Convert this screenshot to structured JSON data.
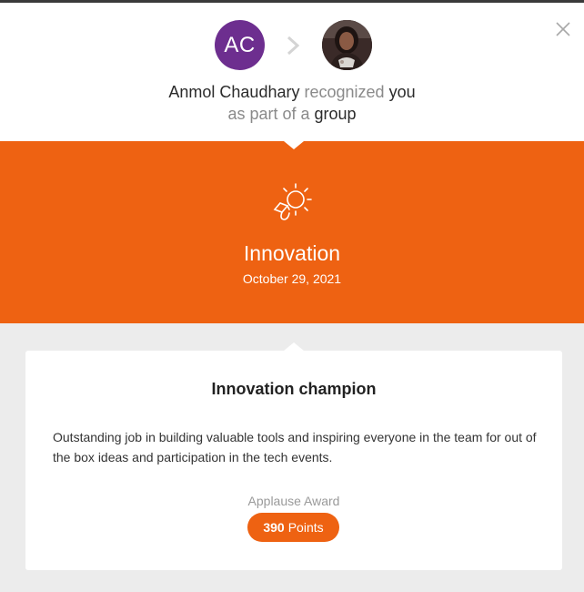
{
  "header": {
    "sender_initials": "AC",
    "sender_name": "Anmol Chaudhary",
    "verb": "recognized",
    "recipient": "you",
    "line2_prefix": "as part of a",
    "line2_strong": "group"
  },
  "award": {
    "name": "Innovation",
    "date": "October 29, 2021",
    "icon": "lightbulb-hand-icon"
  },
  "card": {
    "title": "Innovation champion",
    "message": "Outstanding job in building valuable tools and inspiring everyone in the team for out of the box ideas and participation in the tech events.",
    "award_type": "Applause Award",
    "points_value": "390",
    "points_label": "Points"
  },
  "colors": {
    "accent": "#ee6212",
    "avatar_bg": "#6d2e8f",
    "page_bg": "#ececec"
  }
}
